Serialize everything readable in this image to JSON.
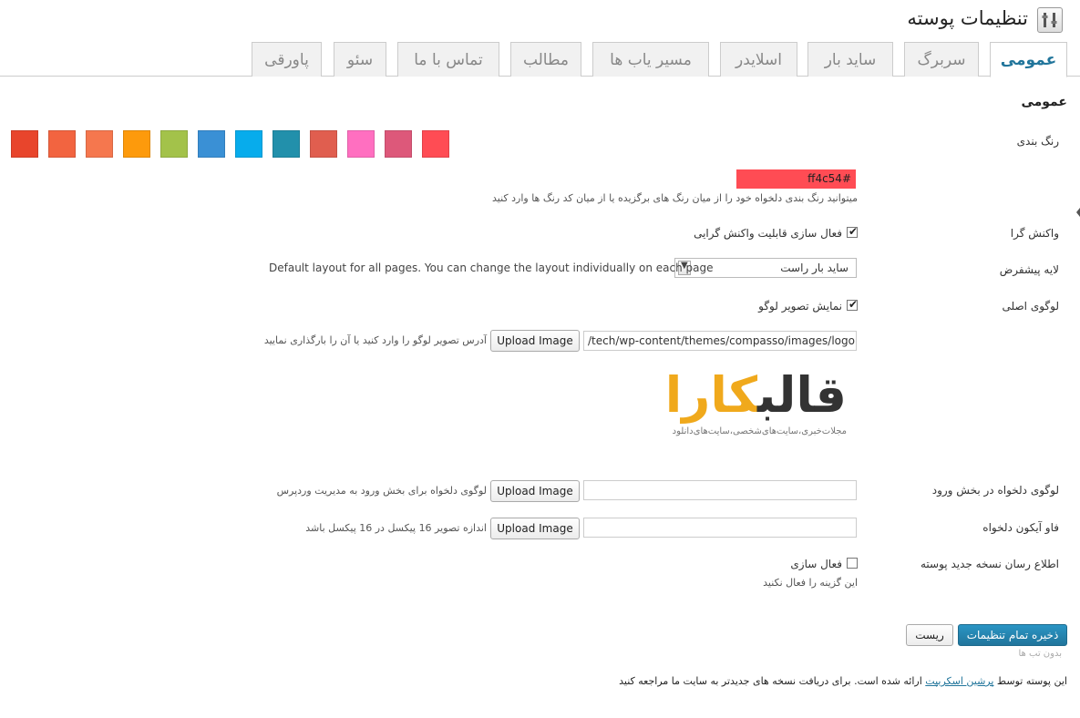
{
  "header": {
    "title": "تنظیمات پوسته"
  },
  "tabs": [
    {
      "label": "عمومی",
      "active": true
    },
    {
      "label": "سربرگ"
    },
    {
      "label": "ساید بار"
    },
    {
      "label": "اسلایدر"
    },
    {
      "label": "مسیر یاب ها"
    },
    {
      "label": "مطالب"
    },
    {
      "label": "تماس با ما"
    },
    {
      "label": "سئو"
    },
    {
      "label": "پاورقی"
    }
  ],
  "section_title": "عمومی",
  "color": {
    "label": "رنگ بندی",
    "swatches": [
      "#e8452c",
      "#f26440",
      "#f5774e",
      "#fd9a0c",
      "#a3c24a",
      "#3a90d5",
      "#07acec",
      "#2290ab",
      "#e05e4f",
      "#ff6fc0",
      "#dd587a",
      "#ff4c54"
    ],
    "value": "ff4c54#",
    "description": "میتوانید رنگ بندی دلخواه خود را از میان رنگ های برگزیده یا از میان کد رنگ ها وارد کنید"
  },
  "responsive": {
    "label": "واکنش گرا",
    "checkbox_label": "فعال سازی قابلیت واکنش گرایی",
    "checked": true
  },
  "layout": {
    "label": "لایه پیشفرض",
    "selected": "ساید بار راست",
    "description": "Default layout for all pages. You can change the layout individually on each page"
  },
  "main_logo": {
    "label": "لوگوی اصلی",
    "checkbox_label": "نمایش تصویر لوگو",
    "checked": true,
    "url": "/tech/wp-content/themes/compasso/images/logo.png",
    "upload_label": "Upload Image",
    "description": "آدرس تصویر لوگو را وارد کنید یا آن را بارگذاری نمایید",
    "logo_word_1": "قالب",
    "logo_word_2": "کارا",
    "logo_tagline": "مجلات‌خبری،سایت‌های‌شخصی،سایت‌های‌دانلود"
  },
  "login_logo": {
    "label": "لوگوی دلخواه در بخش ورود",
    "upload_label": "Upload Image",
    "description": "لوگوی دلخواه برای بخش ورود به مدیریت وردپرس"
  },
  "favicon": {
    "label": "فاو آیکون دلخواه",
    "upload_label": "Upload Image",
    "description": "اندازه تصویر 16 پیکسل در 16 پیکسل باشد"
  },
  "update_notice": {
    "label": "اطلاع رسان نسخه جدید پوسته",
    "checkbox_label": "فعال سازی",
    "checked": false,
    "description": "این گزینه را فعال نکنید"
  },
  "actions": {
    "save_label": "ذخیره تمام تنظیمات",
    "reset_label": "ریست",
    "hint": "بدون تب ها"
  },
  "footer": {
    "prefix": "این پوسته توسط",
    "link": "پرشین اسکریپت",
    "suffix": "ارائه شده است. برای دریافت نسخه های جدیدتر به سایت ما مراجعه کنید"
  }
}
